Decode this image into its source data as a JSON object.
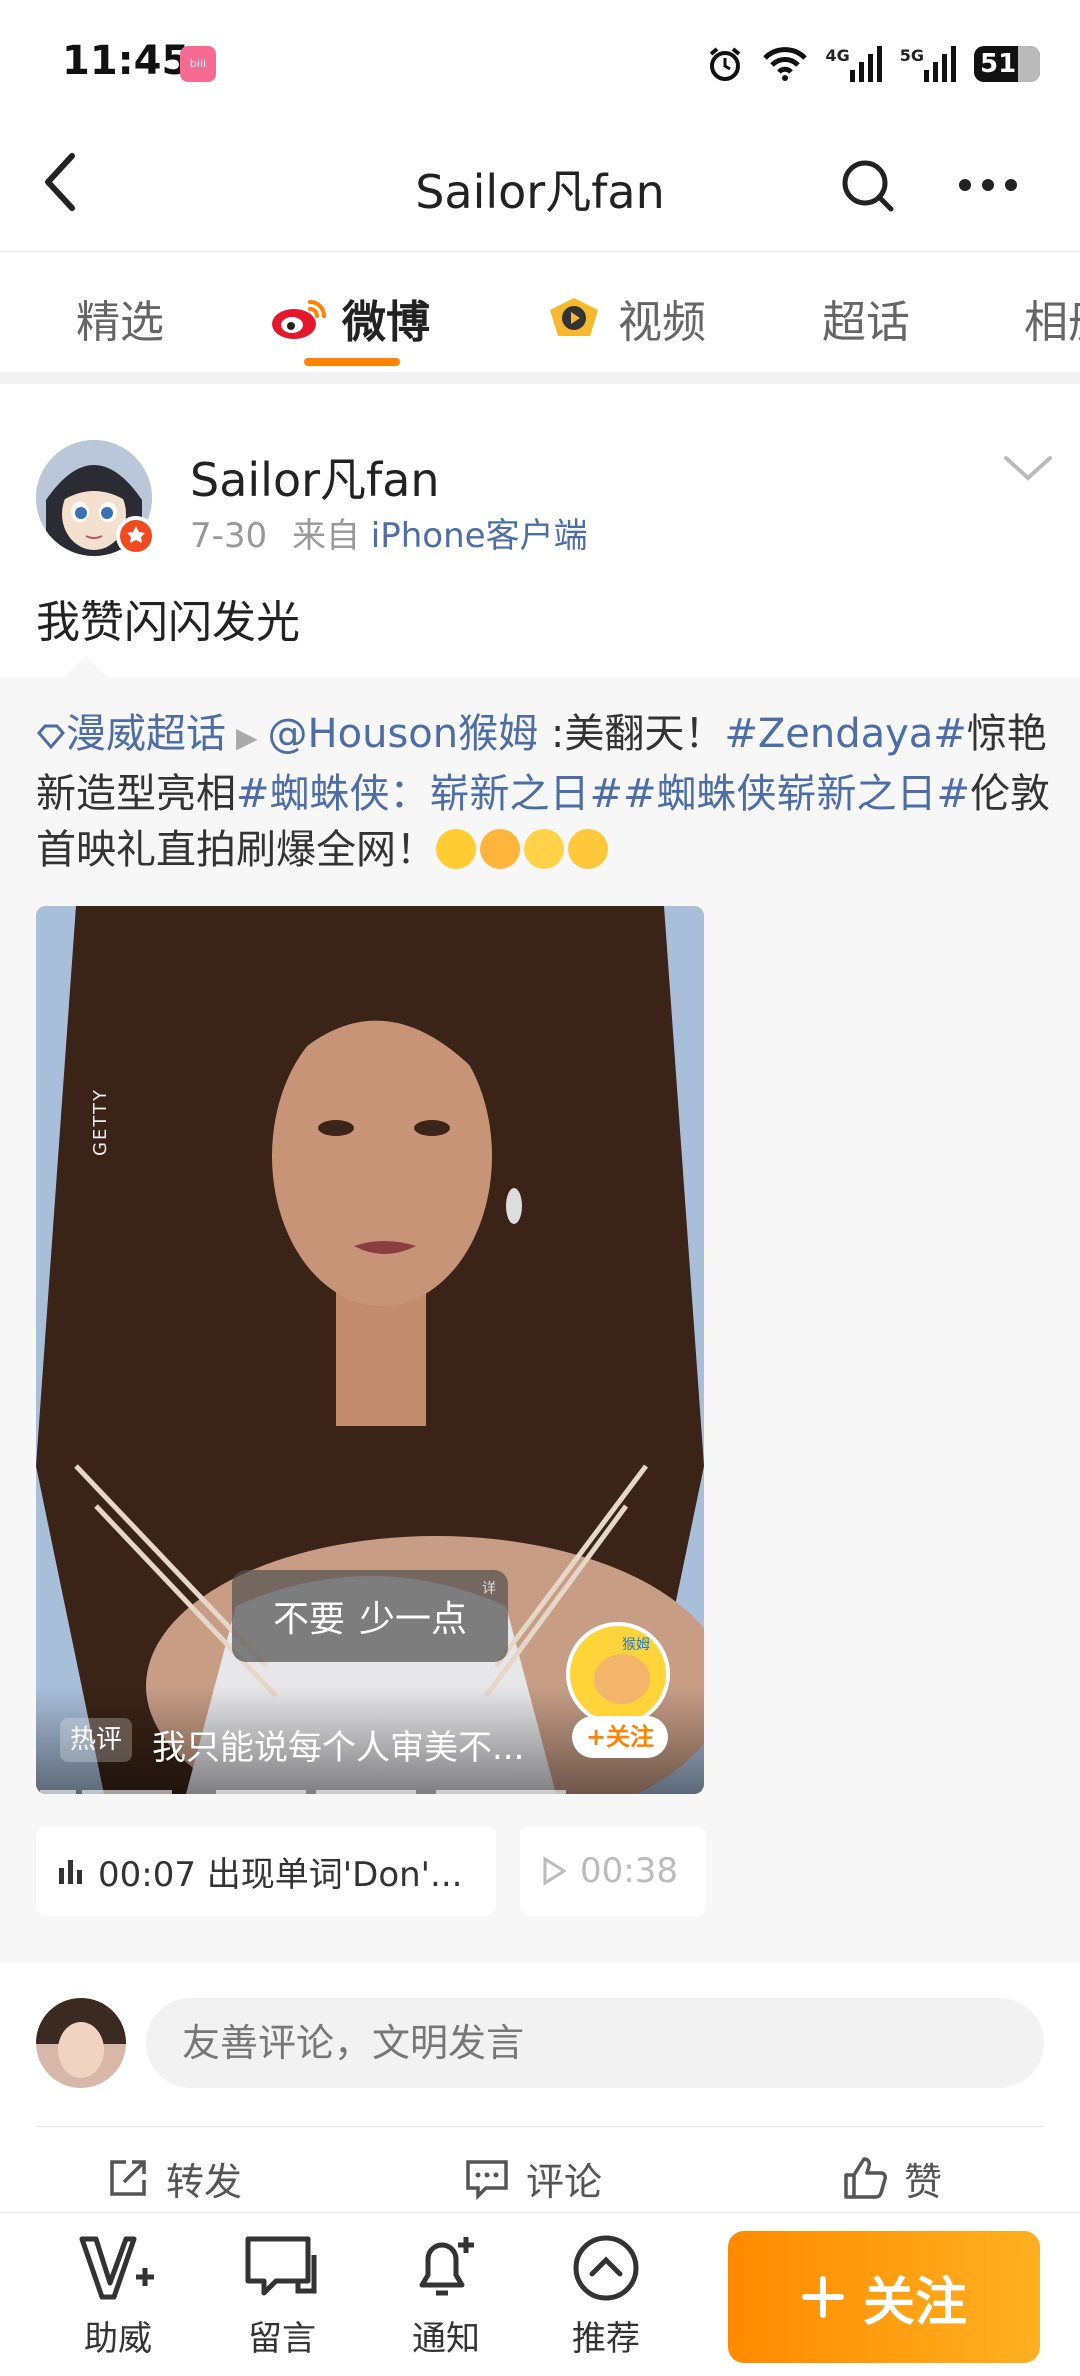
{
  "status_bar": {
    "time": "11:45",
    "battery": "51",
    "net_4g": "4G",
    "net_5g": "5G"
  },
  "nav": {
    "title": "Sailor凡fan"
  },
  "tabs": [
    {
      "label": "精选"
    },
    {
      "label": "微博"
    },
    {
      "label": "视频"
    },
    {
      "label": "超话"
    },
    {
      "label": "相册"
    }
  ],
  "post": {
    "author": "Sailor凡fan",
    "date": "7-30",
    "from_prefix": "来自",
    "source": "iPhone客户端",
    "text": "我赞闪闪发光"
  },
  "repost": {
    "topic": "漫威超话",
    "mention": "@Houson猴姆",
    "text_1": ":美翻天！",
    "tag_1": "#Zendaya#",
    "text_2": "惊艳新造型亮相",
    "tag_2": "#蜘蛛侠：崭新之日#",
    "tag_3": "#蜘蛛侠崭新之日#",
    "text_3": "伦敦首映礼直拍刷爆全网！",
    "video": {
      "watermark": "GETTY",
      "feedback_option_1": "不要",
      "feedback_option_2": "少一点",
      "feedback_tip": "详",
      "hot_tag": "热评",
      "hot_comment": "我只能说每个人审美不...",
      "mascot_label": "猴姆",
      "follow_chip": "+关注"
    },
    "chip_1": "00:07 出现单词'Don'...",
    "chip_2": "00:38"
  },
  "comment": {
    "placeholder": "友善评论，文明发言"
  },
  "actions": {
    "repost": "转发",
    "comment": "评论",
    "like": "赞"
  },
  "bottom_bar": {
    "item_1": "助威",
    "item_2": "留言",
    "item_3": "通知",
    "item_4": "推荐",
    "follow": "关注"
  },
  "colors": {
    "accent": "#ff8200",
    "link": "#4b6ea8"
  }
}
